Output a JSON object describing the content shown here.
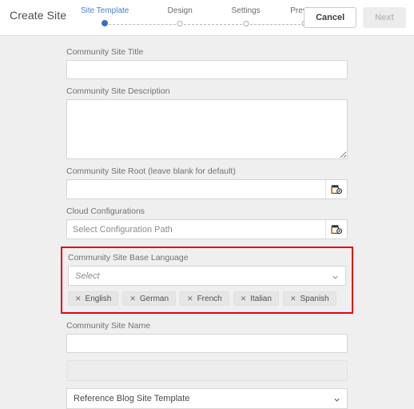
{
  "header": {
    "title": "Create Site",
    "steps": [
      {
        "label": "Site Template",
        "state": "active"
      },
      {
        "label": "Design",
        "state": "inactive"
      },
      {
        "label": "Settings",
        "state": "inactive"
      },
      {
        "label": "Preview",
        "state": "inactive"
      }
    ],
    "cancel_label": "Cancel",
    "next_label": "Next",
    "active_color": "#4a7fd4",
    "active_dot_color": "#3b6fc4"
  },
  "form": {
    "site_title": {
      "label": "Community Site Title",
      "value": "",
      "placeholder": ""
    },
    "site_description": {
      "label": "Community Site Description",
      "value": "",
      "placeholder": ""
    },
    "site_root": {
      "label": "Community Site Root (leave blank for default)",
      "value": "",
      "placeholder": "",
      "picker_icon": "folder-browse-icon"
    },
    "cloud_configurations": {
      "label": "Cloud Configurations",
      "value": "",
      "placeholder": "Select Configuration Path",
      "picker_icon": "folder-browse-icon"
    },
    "base_language": {
      "label": "Community Site Base Language",
      "selected": "Select",
      "is_placeholder": true,
      "chevron_icon": "chevron-down-icon",
      "highlight_color": "#e30613",
      "chips": [
        {
          "label": "English",
          "remove_icon": "close-icon"
        },
        {
          "label": "German",
          "remove_icon": "close-icon"
        },
        {
          "label": "French",
          "remove_icon": "close-icon"
        },
        {
          "label": "Italian",
          "remove_icon": "close-icon"
        },
        {
          "label": "Spanish",
          "remove_icon": "close-icon"
        }
      ]
    },
    "site_name": {
      "label": "Community Site Name",
      "value": "",
      "placeholder": ""
    },
    "readonly_field": {
      "value": ""
    },
    "site_template": {
      "selected": "Reference Blog Site Template",
      "chevron_icon": "chevron-down-icon"
    }
  }
}
